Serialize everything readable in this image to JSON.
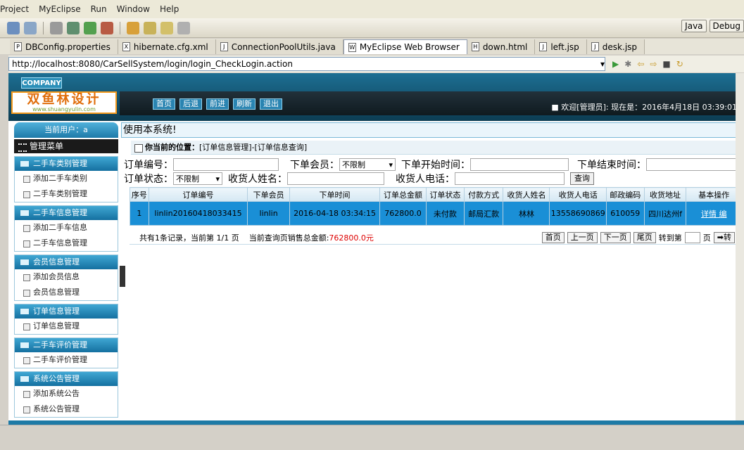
{
  "menu": [
    "Project",
    "MyEclipse",
    "Run",
    "Window",
    "Help"
  ],
  "perspectives": {
    "java": "Java",
    "debug": "Debug"
  },
  "tabs": [
    {
      "label": "DBConfig.properties",
      "icon": "P"
    },
    {
      "label": "hibernate.cfg.xml",
      "icon": "X"
    },
    {
      "label": "ConnectionPoolUtils.java",
      "icon": "J"
    },
    {
      "label": "MyEclipse Web Browser",
      "icon": "W"
    },
    {
      "label": "down.html",
      "icon": "H"
    },
    {
      "label": "left.jsp",
      "icon": "J"
    },
    {
      "label": "desk.jsp",
      "icon": "J"
    }
  ],
  "url": "http://localhost:8080/CarSellSystem/login/login_CheckLogin.action",
  "header": {
    "company": "COMPANY",
    "logo_text": "双鱼林设计",
    "logo_sub": "www.shuangyulin.com",
    "nav": [
      "首页",
      "后退",
      "前进",
      "刷新",
      "退出"
    ],
    "welcome": "■ 欢迎[管理员]: 现在是：2016年4月18日 03:39:01"
  },
  "sidebar": {
    "current_user": "当前用户：a",
    "menu_title": "管理菜单",
    "groups": [
      {
        "title": "二手车类别管理",
        "items": [
          "添加二手车类别",
          "二手车类别管理"
        ]
      },
      {
        "title": "二手车信息管理",
        "items": [
          "添加二手车信息",
          "二手车信息管理"
        ]
      },
      {
        "title": "会员信息管理",
        "items": [
          "添加会员信息",
          "会员信息管理"
        ]
      },
      {
        "title": "订单信息管理",
        "items": [
          "订单信息管理"
        ]
      },
      {
        "title": "二手车评价管理",
        "items": [
          "二手车评价管理"
        ]
      },
      {
        "title": "系统公告管理",
        "items": [
          "添加系统公告",
          "系统公告管理"
        ]
      }
    ]
  },
  "main": {
    "top_message": "使用本系统!",
    "position_label": "你当前的位置：",
    "position_path": "[订单信息管理]-[订单信息查询]",
    "filters": {
      "order_no": "订单编号：",
      "member": "下单会员：",
      "member_value": "不限制",
      "start_time": "下单开始时间：",
      "end_time": "下单结束时间：",
      "status": "订单状态：",
      "status_value": "不限制",
      "receiver_name": "收货人姓名：",
      "receiver_phone": "收货人电话：",
      "query": "查询"
    },
    "table": {
      "headers": [
        "序号",
        "订单编号",
        "下单会员",
        "下单时间",
        "订单总金额",
        "订单状态",
        "付款方式",
        "收货人姓名",
        "收货人电话",
        "邮政编码",
        "收货地址",
        "基本操作"
      ],
      "rows": [
        [
          "1",
          "linlin20160418033415",
          "linlin",
          "2016-04-18 03:34:15",
          "762800.0",
          "未付款",
          "邮局汇款",
          "林林",
          "13558690869",
          "610059",
          "四川达州f",
          "详情 编"
        ]
      ]
    },
    "pager": {
      "summary": "共有1条记录，当前第 1/1 页",
      "total_label": "当前查询页销售总金额:",
      "total_value": "762800.0元",
      "first": "首页",
      "prev": "上一页",
      "next": "下一页",
      "last": "尾页",
      "goto": "转到第",
      "page": "页",
      "go": "➡转"
    }
  }
}
